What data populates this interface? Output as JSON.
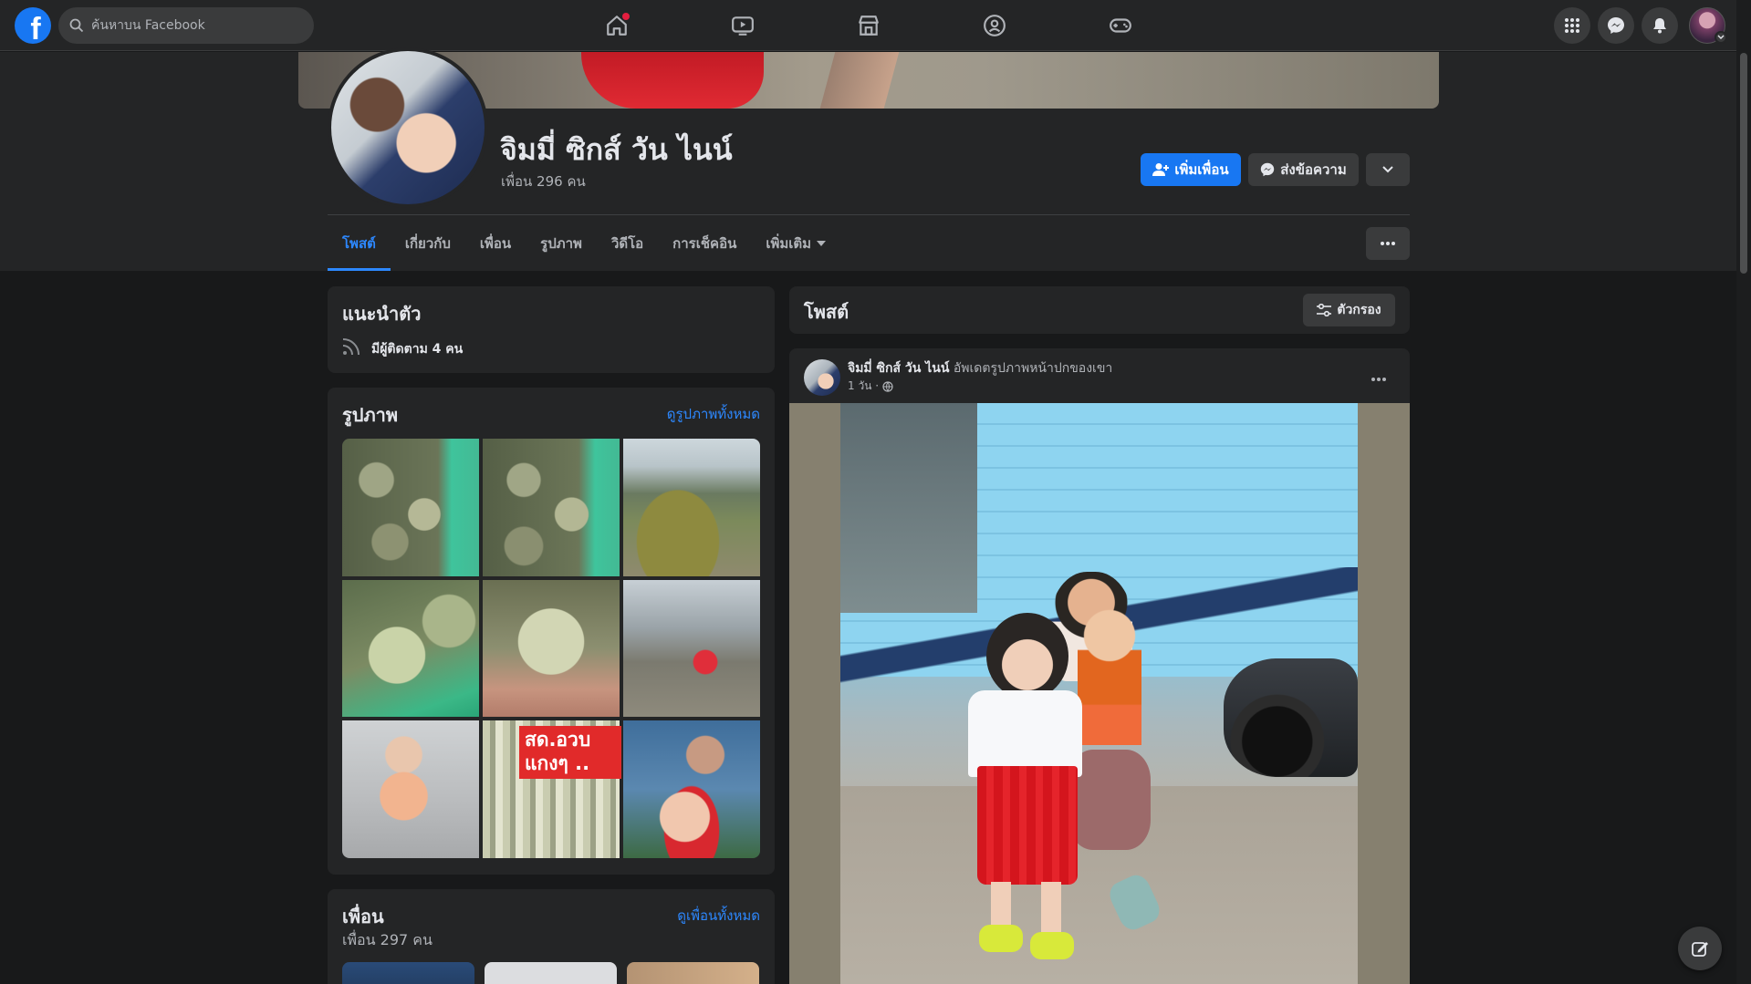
{
  "topbar": {
    "logo": "f",
    "search_placeholder": "ค้นหาบน Facebook"
  },
  "profile": {
    "name": "จิมมี่ ซิกส์ วัน ไนน์",
    "friends_count": "เพื่อน 296 คน",
    "add_friend_label": "เพิ่มเพื่อน",
    "message_label": "ส่งข้อความ"
  },
  "tabs": [
    {
      "label": "โพสต์"
    },
    {
      "label": "เกี่ยวกับ"
    },
    {
      "label": "เพื่อน"
    },
    {
      "label": "รูปภาพ"
    },
    {
      "label": "วิดีโอ"
    },
    {
      "label": "การเช็คอิน"
    },
    {
      "label": "เพิ่มเติม"
    }
  ],
  "intro": {
    "title": "แนะนำตัว",
    "followers": "มีผู้ติดตาม 4 คน"
  },
  "photos": {
    "title": "รูปภาพ",
    "see_all": "ดูรูปภาพทั้งหมด",
    "overlay_text_line1": "สด.อวบ",
    "overlay_text_line2": "แกงๆ .."
  },
  "friends": {
    "title": "เพื่อน",
    "count": "เพื่อน 297 คน",
    "see_all": "ดูเพื่อนทั้งหมด"
  },
  "posts": {
    "title": "โพสต์",
    "filter_label": "ตัวกรอง"
  },
  "post": {
    "author": "จิมมี่ ซิกส์ วัน ไนน์",
    "action": "อัพเดตรูปภาพหน้าปกของเขา",
    "time": "1 วัน ·"
  },
  "colors": {
    "accent": "#1877f2",
    "link": "#2d88ff",
    "background": "#18191a",
    "card": "#242526",
    "notification": "#e41e3f"
  }
}
